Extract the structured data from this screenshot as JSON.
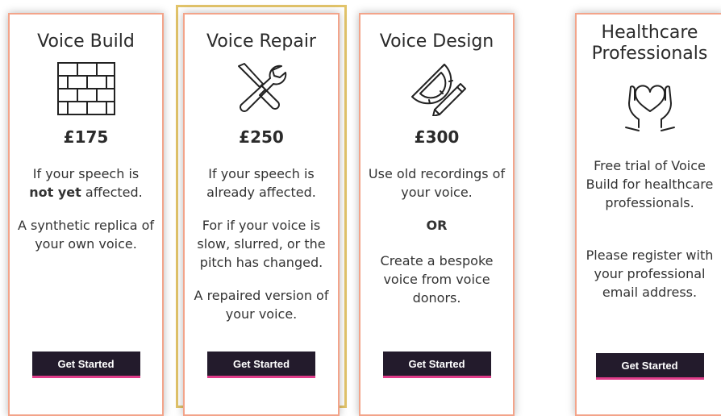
{
  "cards": [
    {
      "title": "Voice Build",
      "price": "£175",
      "para1_pre": "If your speech is",
      "para1_bold": "not yet",
      "para1_post": "affected.",
      "para2": "A synthetic replica of your own voice.",
      "button": "Get Started"
    },
    {
      "title": "Voice Repair",
      "price": "£250",
      "para1": "If your speech is already affected.",
      "para2": "For if your voice is slow, slurred, or the pitch has changed.",
      "para3": "A repaired version of your voice.",
      "button": "Get Started"
    },
    {
      "title": "Voice Design",
      "price": "£300",
      "para1": "Use old recordings of your voice.",
      "or": "OR",
      "para2": "Create a bespoke voice from voice donors.",
      "button": "Get Started"
    },
    {
      "title": "Healthcare Professionals",
      "para1": "Free trial of Voice Build for healthcare professionals.",
      "para2": "Please register with your professional email address.",
      "button": "Get Started"
    }
  ],
  "icons": [
    "brick-wall-icon",
    "wrench-screwdriver-icon",
    "protractor-pencil-icon",
    "heart-hands-icon"
  ],
  "colors": {
    "card_border": "#f3a48a",
    "highlight_border": "#e2c46a",
    "button_bg": "#231b2c",
    "button_accent": "#e03c8a"
  }
}
